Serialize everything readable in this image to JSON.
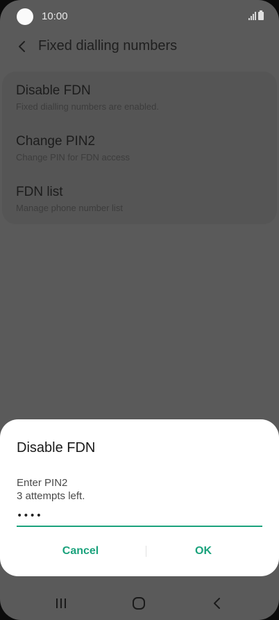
{
  "status_bar": {
    "time": "10:00",
    "icons": [
      "signal-icon",
      "battery-icon"
    ]
  },
  "app_bar": {
    "back_icon": "chevron-left-icon",
    "title": "Fixed dialling numbers"
  },
  "settings": {
    "items": [
      {
        "title": "Disable FDN",
        "subtitle": "Fixed dialling numbers are enabled."
      },
      {
        "title": "Change PIN2",
        "subtitle": "Change PIN for FDN access"
      },
      {
        "title": "FDN list",
        "subtitle": "Manage phone number list"
      }
    ]
  },
  "dialog": {
    "title": "Disable FDN",
    "message_line1": "Enter PIN2",
    "message_line2": "3 attempts left.",
    "pin_value": "••••",
    "cancel_label": "Cancel",
    "ok_label": "OK"
  },
  "nav_bar": {
    "icons": [
      "recents-icon",
      "home-icon",
      "back-icon"
    ]
  },
  "colors": {
    "accent": "#1aa27c",
    "scrim_background": "#5a5a5a",
    "dialog_background": "#ffffff"
  }
}
